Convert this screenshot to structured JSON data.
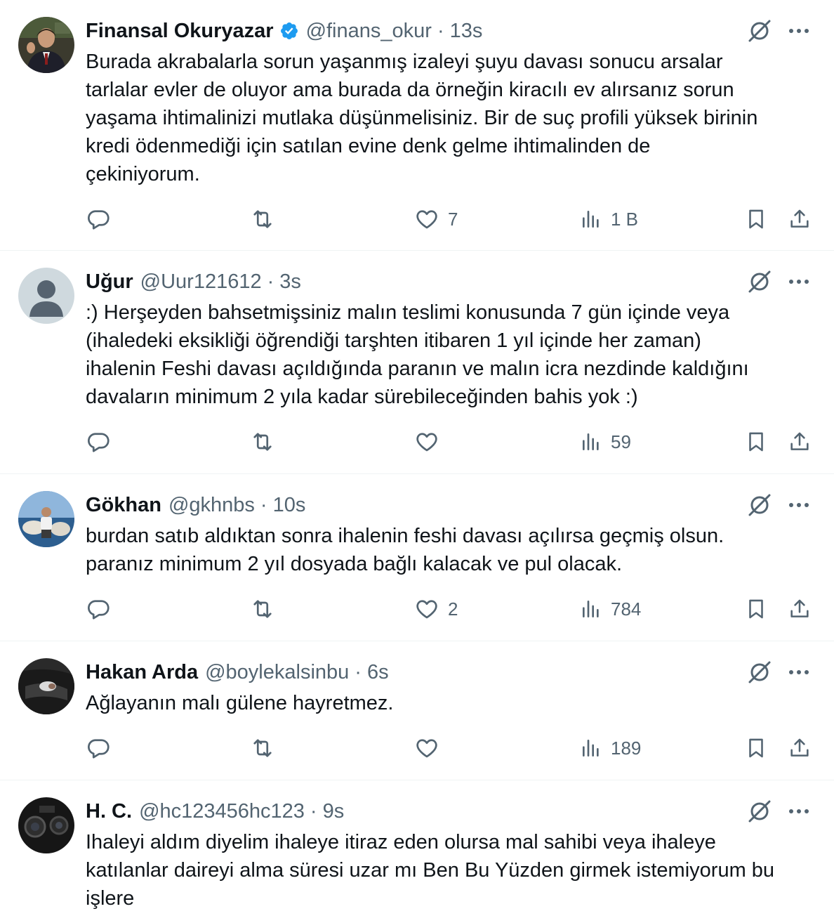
{
  "tweets": [
    {
      "name": "Finansal Okuryazar",
      "verified": true,
      "handle": "@finans_okur",
      "sep": "·",
      "time": "13s",
      "lines": [
        "Burada akrabalarla sorun yaşanmış izaleyi şuyu davası sonucu arsalar",
        "tarlalar evler de oluyor ama burada da örneğin kiracılı ev alırsanız sorun",
        "yaşama ihtimalinizi mutlaka düşünmelisiniz. Bir de suç profili yüksek birinin",
        "kredi ödenmediği için satılan evine denk gelme ihtimalinden de",
        "çekiniyorum."
      ],
      "likes": "7",
      "views": "1 B"
    },
    {
      "name": "Uğur",
      "verified": false,
      "handle": "@Uur121612",
      "sep": "·",
      "time": "3s",
      "lines": [
        ":) Herşeyden bahsetmişsiniz malın teslimi konusunda 7 gün içinde veya",
        "(ihaledeki eksikliği öğrendiği tarşhten itibaren 1 yıl içinde her zaman)",
        "ihalenin Feshi davası açıldığında paranın ve malın icra nezdinde kaldığını",
        "davaların minimum 2 yıla kadar sürebileceğinden bahis yok :)"
      ],
      "likes": "",
      "views": "59"
    },
    {
      "name": "Gökhan",
      "verified": false,
      "handle": "@gkhnbs",
      "sep": "·",
      "time": "10s",
      "lines": [
        "burdan satıb aldıktan sonra ihalenin feshi davası açılırsa geçmiş olsun.",
        "paranız minimum 2 yıl dosyada bağlı kalacak ve pul olacak."
      ],
      "likes": "2",
      "views": "784"
    },
    {
      "name": "Hakan Arda",
      "verified": false,
      "handle": "@boylekalsinbu",
      "sep": "·",
      "time": "6s",
      "lines": [
        "Ağlayanın malı gülene hayretmez."
      ],
      "likes": "",
      "views": "189"
    },
    {
      "name": "H. C.",
      "verified": false,
      "handle": "@hc123456hc123",
      "sep": "·",
      "time": "9s",
      "lines": [
        "Ihaleyi aldım diyelim ihaleye itiraz eden olursa mal sahibi veya ihaleye",
        "katılanlar daireyi alma süresi uzar mı Ben Bu Yüzden girmek istemiyorum bu",
        "işlere"
      ],
      "likes": null,
      "views": null
    }
  ],
  "colors": {
    "text": "#0f1419",
    "secondary": "#536471",
    "verified": "#1d9bf0",
    "divider": "#eff3f4"
  },
  "icons": [
    "grok-icon",
    "more-icon",
    "reply-icon",
    "retweet-icon",
    "like-icon",
    "views-icon",
    "bookmark-icon",
    "share-icon",
    "verified-badge-icon"
  ]
}
